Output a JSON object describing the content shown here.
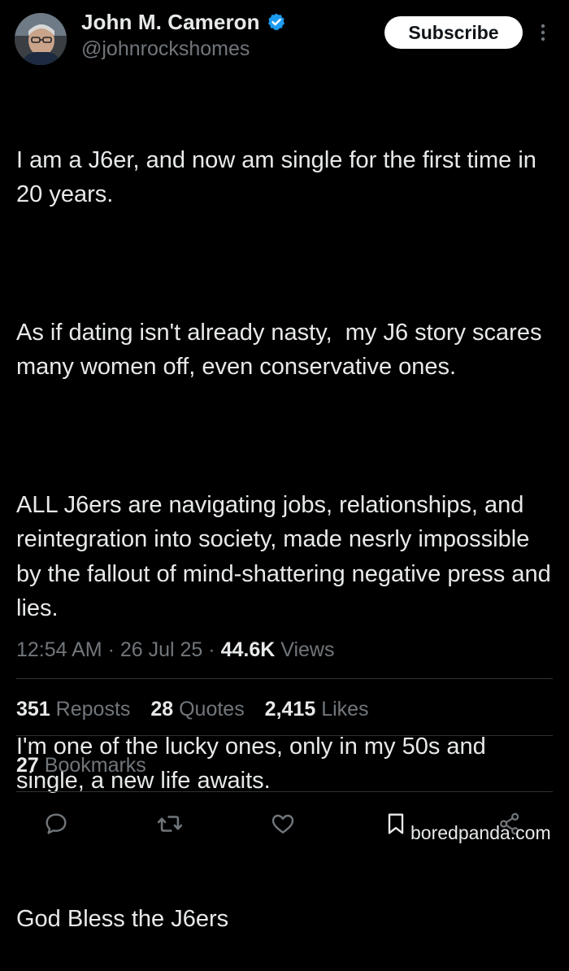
{
  "author": {
    "display_name": "John M. Cameron",
    "handle": "@johnrockshomes",
    "verified": true,
    "verified_color": "#1d9bf0"
  },
  "header": {
    "subscribe_label": "Subscribe",
    "more_icon": "more-vertical-icon"
  },
  "tweet": {
    "paragraphs": [
      "I am a J6er, and now am single for the first time in 20 years.",
      "As if dating isn't already nasty,  my J6 story scares many women off, even conservative ones.",
      "ALL J6ers are navigating jobs, relationships, and reintegration into society, made nesrly impossible  by the fallout of mind-shattering negative press and lies.",
      "I'm one of the lucky ones, only in my 50s and single, a new life awaits.",
      "God Bless the J6ers"
    ]
  },
  "meta": {
    "time": "12:54 AM",
    "separator": "·",
    "date": "26 Jul 25",
    "views_count": "44.6K",
    "views_label": "Views"
  },
  "stats": {
    "reposts_count": "351",
    "reposts_label": "Reposts",
    "quotes_count": "28",
    "quotes_label": "Quotes",
    "likes_count": "2,415",
    "likes_label": "Likes",
    "bookmarks_count": "27",
    "bookmarks_label": "Bookmarks"
  },
  "actions": [
    {
      "name": "reply-icon"
    },
    {
      "name": "repost-icon"
    },
    {
      "name": "like-icon"
    },
    {
      "name": "bookmark-icon"
    },
    {
      "name": "share-icon"
    }
  ],
  "watermark": {
    "text": "boredpanda.com"
  },
  "colors": {
    "background": "#000000",
    "text_primary": "#e7e9ea",
    "text_secondary": "#71767b",
    "divider": "#2f3336"
  }
}
